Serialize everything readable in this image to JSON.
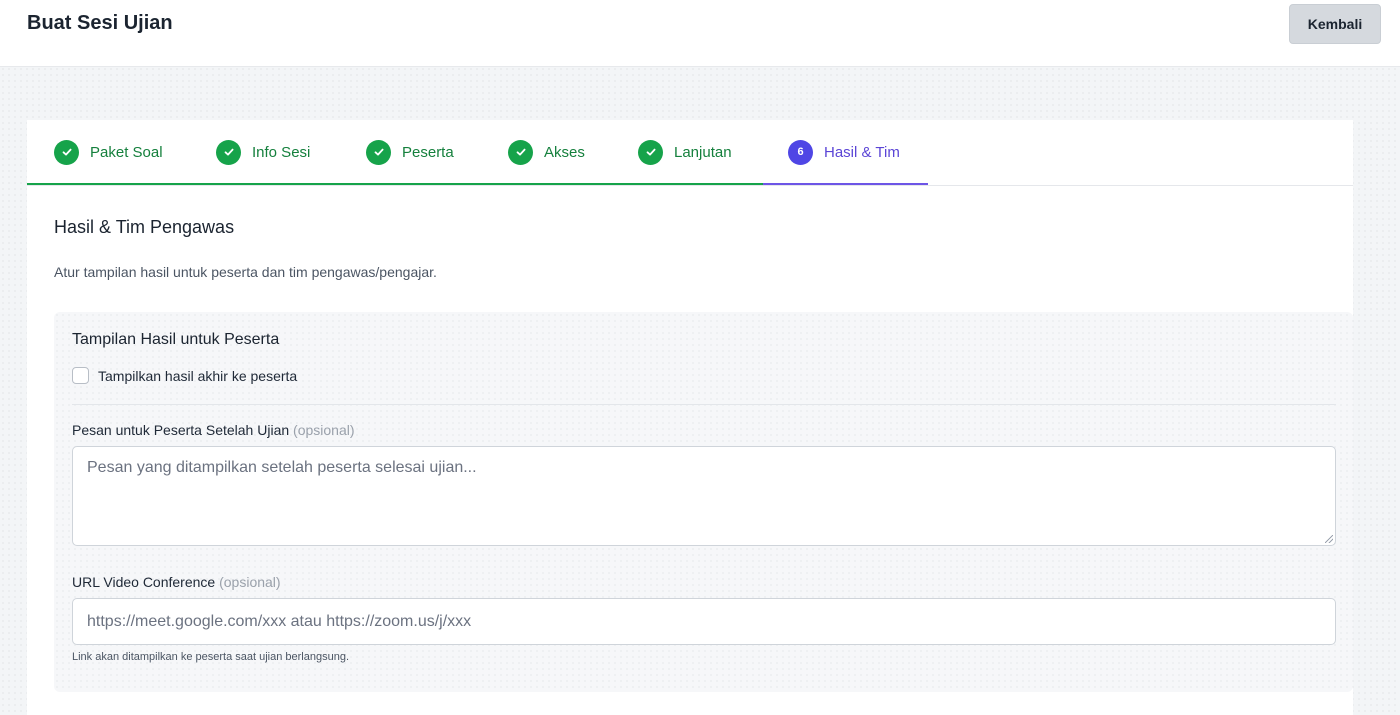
{
  "header": {
    "title": "Buat Sesi Ujian",
    "back_label": "Kembali"
  },
  "stepper": {
    "steps": [
      {
        "label": "Paket Soal",
        "state": "done"
      },
      {
        "label": "Info Sesi",
        "state": "done"
      },
      {
        "label": "Peserta",
        "state": "done"
      },
      {
        "label": "Akses",
        "state": "done"
      },
      {
        "label": "Lanjutan",
        "state": "done"
      },
      {
        "label": "Hasil & Tim",
        "state": "active",
        "number": "6"
      }
    ]
  },
  "section": {
    "title": "Hasil & Tim Pengawas",
    "description": "Atur tampilan hasil untuk peserta dan tim pengawas/pengajar."
  },
  "results_panel": {
    "title": "Tampilan Hasil untuk Peserta",
    "show_results_label": "Tampilkan hasil akhir ke peserta",
    "show_results_checked": false,
    "message_label": "Pesan untuk Peserta Setelah Ujian",
    "message_optional": "(opsional)",
    "message_placeholder": "Pesan yang ditampilkan setelah peserta selesai ujian...",
    "video_label": "URL Video Conference",
    "video_optional": "(opsional)",
    "video_placeholder": "https://meet.google.com/xxx atau https://zoom.us/j/xxx",
    "video_helper": "Link akan ditampilkan ke peserta saat ujian berlangsung."
  },
  "colors": {
    "done": "#16a34a",
    "active": "#4f46e5"
  }
}
